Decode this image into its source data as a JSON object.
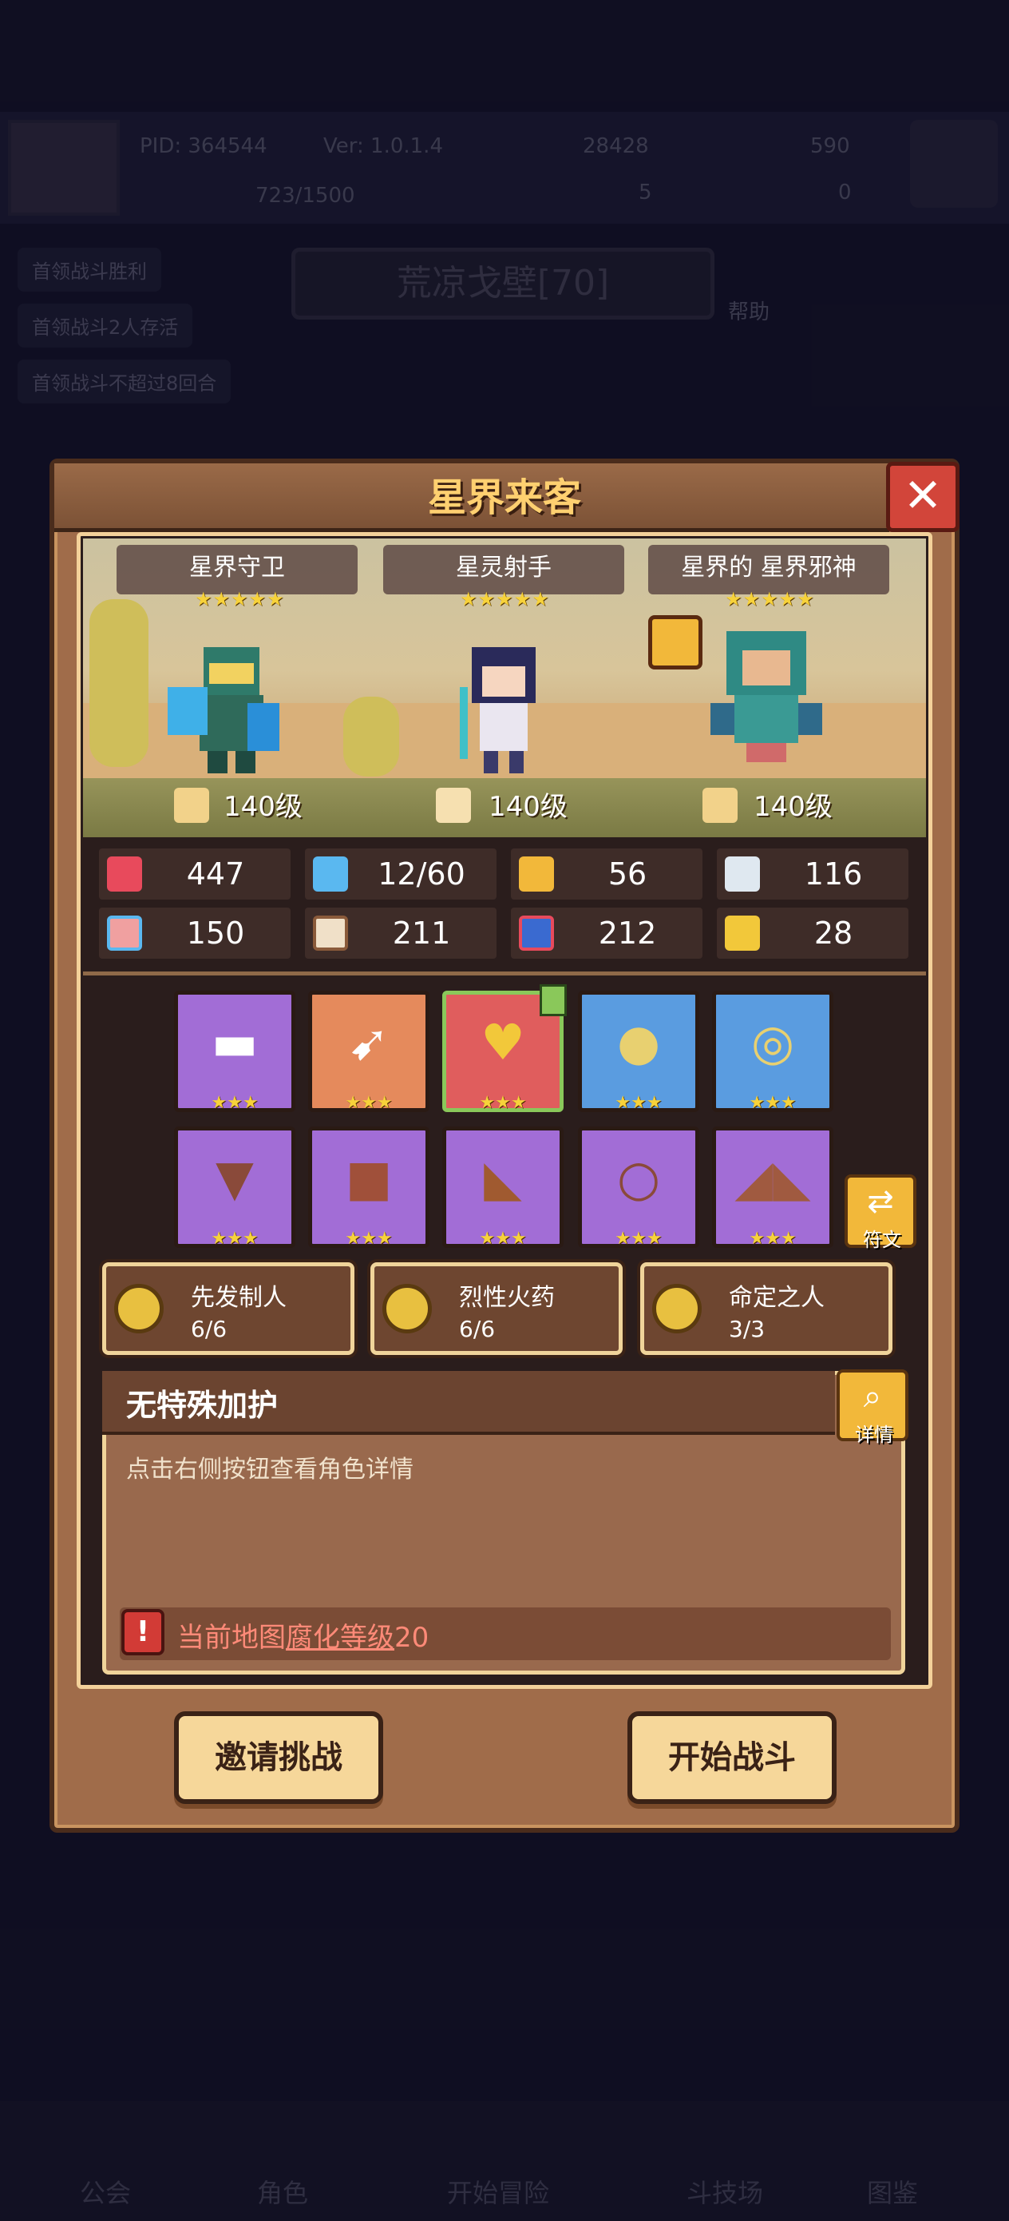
{
  "background": {
    "pid": "PID: 364544",
    "version": "Ver: 1.0.1.4",
    "gold": "28428",
    "gems": "590",
    "exp": "723/1500",
    "count_a": "5",
    "count_b": "0",
    "quests": [
      "首领战斗胜利",
      "首领战斗2人存活",
      "首领战斗不超过8回合"
    ],
    "area_title": "荒凉戈壁[70]",
    "help": "帮助",
    "nav": [
      "公会",
      "角色",
      "开始冒险",
      "斗技场",
      "图鉴"
    ]
  },
  "dialog": {
    "title": "星界来客",
    "close_icon": "close-icon",
    "heroes": [
      {
        "name": "星界守卫",
        "stars": "★★★★★",
        "level": "140级"
      },
      {
        "name": "星灵射手",
        "stars": "★★★★★",
        "level": "140级"
      },
      {
        "name": "星界的 星界邪神",
        "stars": "★★★★★",
        "level": "140级"
      }
    ],
    "stats": [
      {
        "icon": "heart-icon",
        "value": "447",
        "color": "#e84a5c"
      },
      {
        "icon": "mana-drop-icon",
        "value": "12/60",
        "color": "#5ab8f0"
      },
      {
        "icon": "shield-icon",
        "value": "56",
        "color": "#f2b83a"
      },
      {
        "icon": "wing-icon",
        "value": "116",
        "color": "#dfe8f0"
      },
      {
        "icon": "fist-icon",
        "value": "150",
        "color": "#f0a0a0"
      },
      {
        "icon": "book-icon",
        "value": "211",
        "color": "#f0e0c8"
      },
      {
        "icon": "potion-icon",
        "value": "212",
        "color": "#e84a5c"
      },
      {
        "icon": "horseshoe-icon",
        "value": "28",
        "color": "#f2c83a"
      }
    ],
    "equipment_row1": [
      {
        "icon": "gun-icon",
        "stars": "★★★",
        "bg": "purple"
      },
      {
        "icon": "arrow-icon",
        "stars": "★★★",
        "bg": "orange"
      },
      {
        "icon": "necklace-icon",
        "stars": "★★★",
        "bg": "red"
      },
      {
        "icon": "coin-icon",
        "stars": "★★★",
        "bg": "blue"
      },
      {
        "icon": "ring-icon",
        "stars": "★★★",
        "bg": "blue"
      }
    ],
    "equipment_row2": [
      {
        "icon": "cape-icon",
        "stars": "★★★",
        "bg": "purple"
      },
      {
        "icon": "armor-icon",
        "stars": "★★★",
        "bg": "purple"
      },
      {
        "icon": "boot-icon",
        "stars": "★★★",
        "bg": "purple"
      },
      {
        "icon": "belt-icon",
        "stars": "★★★",
        "bg": "purple"
      },
      {
        "icon": "boots-icon",
        "stars": "★★★",
        "bg": "purple"
      }
    ],
    "rune_label": "符文",
    "sets": [
      {
        "name": "先发制人",
        "count": "6/6"
      },
      {
        "name": "烈性火药",
        "count": "6/6"
      },
      {
        "name": "命定之人",
        "count": "3/3"
      }
    ],
    "description": {
      "title": "无特殊加护",
      "body": "点击右侧按钮查看角色详情",
      "detail_label": "详情"
    },
    "warning": {
      "prefix": "当前地图",
      "link": "腐化等级",
      "suffix": "20"
    },
    "buttons": {
      "invite": "邀请挑战",
      "start": "开始战斗"
    }
  }
}
